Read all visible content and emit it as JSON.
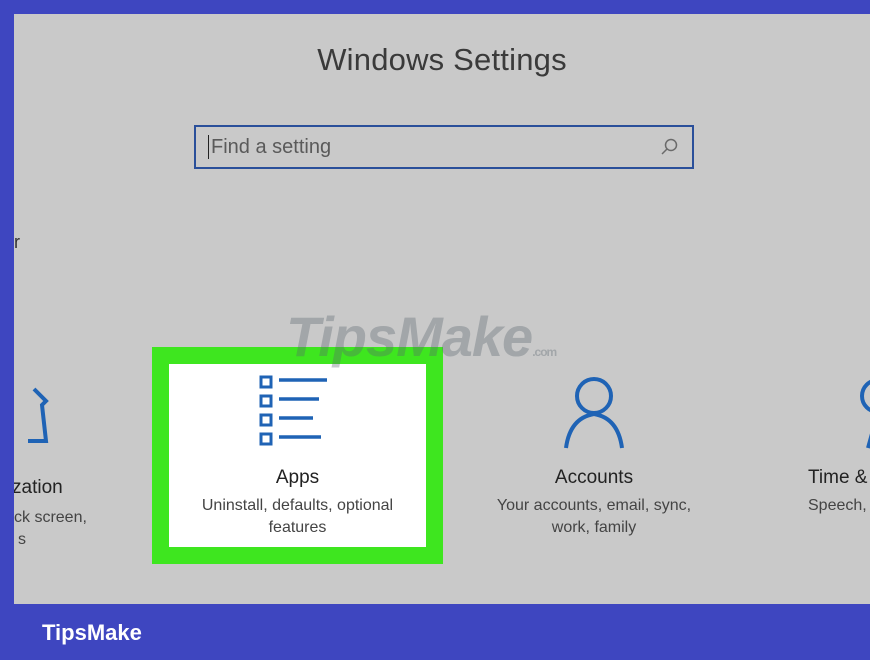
{
  "window": {
    "title": "Windows Settings"
  },
  "search": {
    "placeholder": "Find a setting",
    "icon": "search-icon"
  },
  "left_edge": {
    "stray_char": "r"
  },
  "tiles": {
    "personalization": {
      "name": "zation",
      "desc_line1": "ck screen,",
      "desc_line2": "s",
      "icon": "personalization-icon"
    },
    "apps": {
      "name": "Apps",
      "desc_line1": "Uninstall, defaults, optional",
      "desc_line2": "features",
      "icon": "apps-list-icon",
      "highlight_color": "#3ee61f"
    },
    "accounts": {
      "name": "Accounts",
      "desc_line1": "Your accounts, email, sync,",
      "desc_line2": "work, family",
      "icon": "person-icon"
    },
    "time": {
      "name": "Time &",
      "desc_line1": "Speech,",
      "icon": "time-language-icon"
    }
  },
  "watermark": {
    "text": "TipsMake",
    "suffix": ".com"
  },
  "brand": {
    "label": "TipsMake"
  },
  "colors": {
    "accent": "#1f63b5",
    "frame": "#3e46c0",
    "background": "#c9c9c9"
  }
}
